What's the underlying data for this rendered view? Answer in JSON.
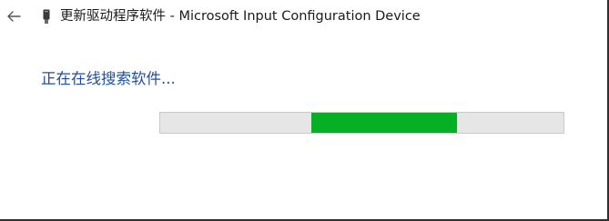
{
  "header": {
    "back_icon": "arrow-left-icon",
    "device_icon": "device-icon",
    "title": "更新驱动程序软件 - Microsoft Input Configuration Device"
  },
  "main": {
    "status_text": "正在在线搜索软件...",
    "progress": {
      "mode": "indeterminate",
      "segment_start_fraction": 0.375,
      "segment_end_fraction": 0.735,
      "fill_color": "#06b025",
      "track_color": "#e6e6e6"
    }
  }
}
